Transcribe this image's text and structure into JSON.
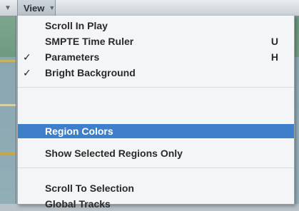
{
  "menubar": {
    "view_title": "View"
  },
  "menu": {
    "items": [
      {
        "label": "Scroll In Play",
        "checked": false,
        "shortcut": ""
      },
      {
        "label": "SMPTE Time Ruler",
        "checked": false,
        "shortcut": "U"
      },
      {
        "label": "Parameters",
        "checked": true,
        "shortcut": "H"
      },
      {
        "label": "Bright Background",
        "checked": true,
        "shortcut": ""
      },
      {
        "label": "Region Colors",
        "checked": false,
        "shortcut": "",
        "highlighted": true
      },
      {
        "label": "Show Selected Regions Only",
        "checked": false,
        "shortcut": ""
      },
      {
        "label": "Scroll To Selection",
        "checked": false,
        "shortcut": ""
      },
      {
        "label": "Global Tracks",
        "checked": false,
        "shortcut": ""
      }
    ],
    "check_glyph": "✓"
  },
  "colors": {
    "highlight": "#3f7ecb",
    "menu_background": "#f3f5f6"
  }
}
